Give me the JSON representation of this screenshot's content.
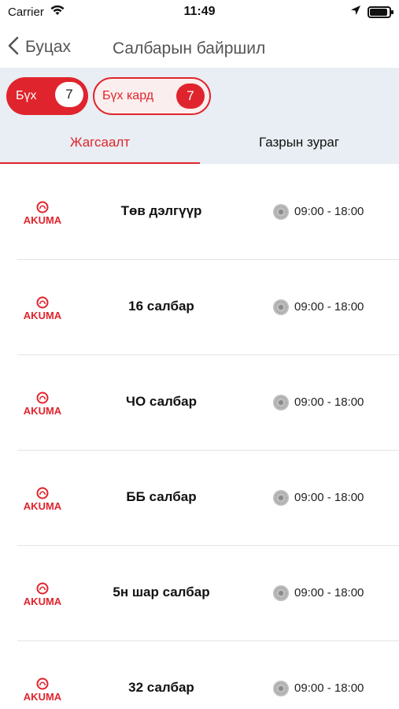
{
  "status_bar": {
    "carrier": "Carrier",
    "time": "11:49",
    "battery_level": 0.9,
    "icons": [
      "wifi-icon",
      "location-arrow-icon",
      "battery-icon"
    ]
  },
  "nav": {
    "back_label": "Буцах",
    "title": "Салбарын байршил"
  },
  "filters": {
    "all": {
      "label": "Бүх",
      "count": "7"
    },
    "card": {
      "label": "Бүх кард",
      "count": "7"
    }
  },
  "tabs": {
    "list": "Жагсаалт",
    "map": "Газрын зураг",
    "active": "list"
  },
  "brand": {
    "logo_text": "AKUMA",
    "accent": "#e0242d"
  },
  "branches": [
    {
      "name": "Төв дэлгүүр",
      "hours": "09:00 - 18:00"
    },
    {
      "name": "16 салбар",
      "hours": "09:00 - 18:00"
    },
    {
      "name": "ЧО  салбар",
      "hours": "09:00 - 18:00"
    },
    {
      "name": "ББ салбар",
      "hours": "09:00 - 18:00"
    },
    {
      "name": "5н шар салбар",
      "hours": "09:00 - 18:00"
    },
    {
      "name": "32 салбар",
      "hours": "09:00 - 18:00"
    }
  ]
}
